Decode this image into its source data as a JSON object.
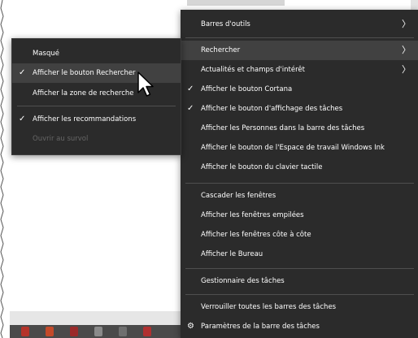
{
  "main_menu": {
    "items": [
      {
        "label": "Barres d'outils",
        "checked": false,
        "submenu": true,
        "highlighted": false
      },
      {
        "label": "Rechercher",
        "checked": false,
        "submenu": true,
        "highlighted": true
      },
      {
        "label": "Actualités et champs d'intérêt",
        "checked": false,
        "submenu": true,
        "highlighted": false
      },
      {
        "label": "Afficher le bouton Cortana",
        "checked": true,
        "submenu": false,
        "highlighted": false
      },
      {
        "label": "Afficher le bouton d'affichage des tâches",
        "checked": true,
        "submenu": false,
        "highlighted": false
      },
      {
        "label": "Afficher les Personnes dans la barre des tâches",
        "checked": false,
        "submenu": false,
        "highlighted": false
      },
      {
        "label": "Afficher le bouton de l'Espace de travail Windows Ink",
        "checked": false,
        "submenu": false,
        "highlighted": false
      },
      {
        "label": "Afficher le bouton du clavier tactile",
        "checked": false,
        "submenu": false,
        "highlighted": false
      },
      {
        "label": "Cascader les fenêtres",
        "checked": false,
        "submenu": false,
        "highlighted": false
      },
      {
        "label": "Afficher les fenêtres empilées",
        "checked": false,
        "submenu": false,
        "highlighted": false
      },
      {
        "label": "Afficher les fenêtres côte à côte",
        "checked": false,
        "submenu": false,
        "highlighted": false
      },
      {
        "label": "Afficher le Bureau",
        "checked": false,
        "submenu": false,
        "highlighted": false
      },
      {
        "label": "Gestionnaire des tâches",
        "checked": false,
        "submenu": false,
        "highlighted": false
      },
      {
        "label": "Verrouiller toutes les barres des tâches",
        "checked": false,
        "submenu": false,
        "highlighted": false
      },
      {
        "label": "Paramètres de la barre des tâches",
        "checked": false,
        "submenu": false,
        "highlighted": false,
        "icon": "gear-icon"
      }
    ]
  },
  "search_submenu": {
    "items": [
      {
        "label": "Masqué",
        "checked": false,
        "highlighted": false,
        "disabled": false
      },
      {
        "label": "Afficher le bouton Rechercher",
        "checked": true,
        "highlighted": true,
        "disabled": false
      },
      {
        "label": "Afficher la zone de recherche",
        "checked": false,
        "highlighted": false,
        "disabled": false
      },
      {
        "label": "Afficher les recommandations",
        "checked": true,
        "highlighted": false,
        "disabled": false
      },
      {
        "label": "Ouvrir au survol",
        "checked": false,
        "highlighted": false,
        "disabled": true
      }
    ]
  },
  "glyphs": {
    "check": "✓",
    "chevron": "〉",
    "gear": "⚙"
  },
  "colors": {
    "menu_bg": "#2b2b2b",
    "highlight": "#414141",
    "separator": "#4f4f4f",
    "text": "#ffffff",
    "disabled_text": "#666666"
  }
}
